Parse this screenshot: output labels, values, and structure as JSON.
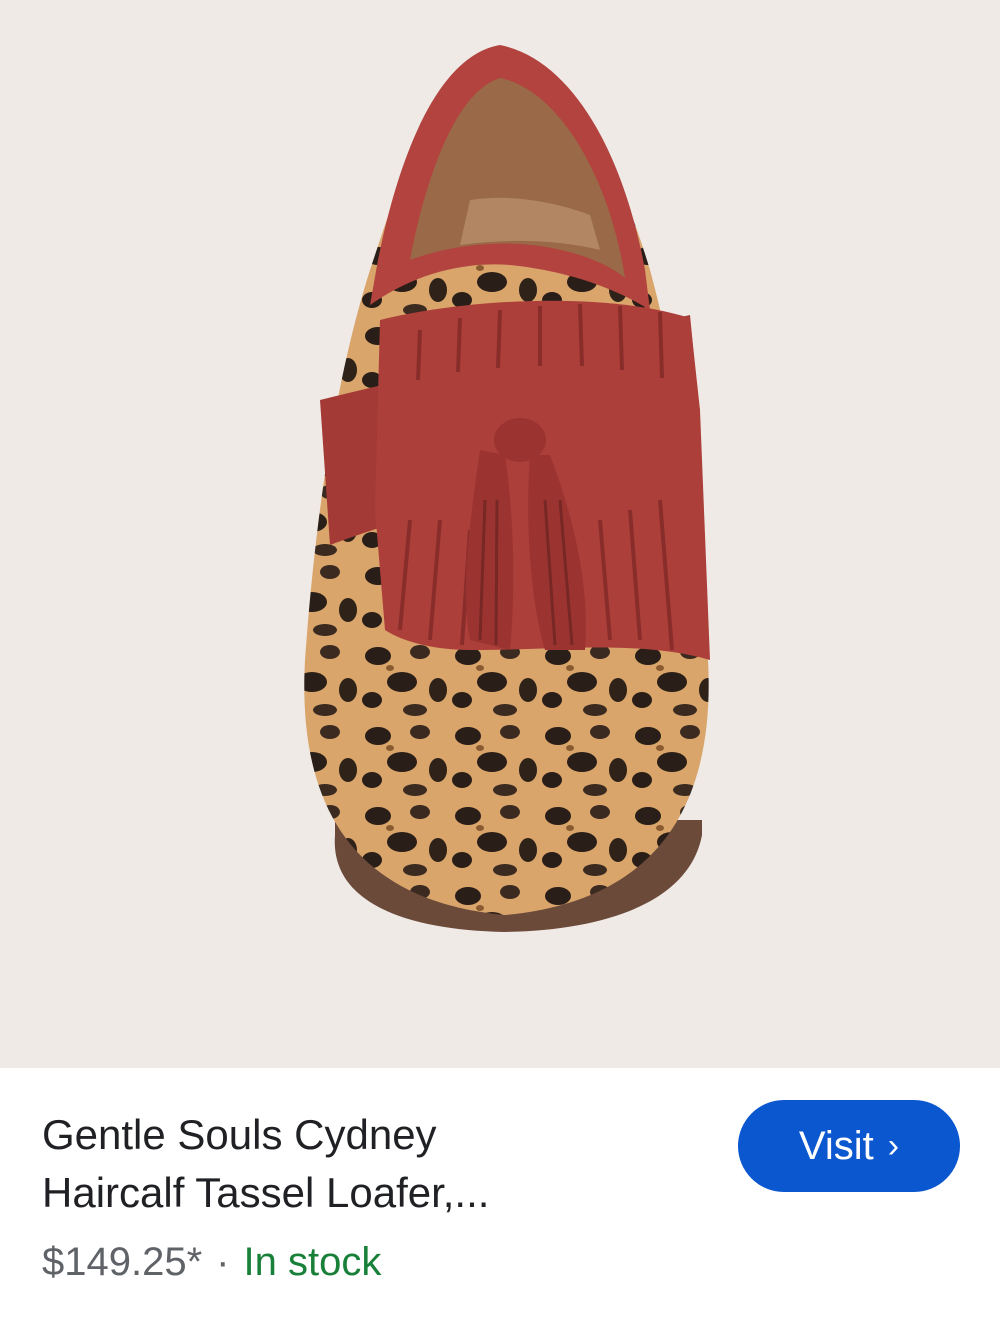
{
  "product": {
    "title_line1": "Gentle Souls Cydney",
    "title_line2": "Haircalf Tassel Loafer,...",
    "price": "$149.25*",
    "separator": "·",
    "stock_status": "In stock",
    "image_alt": "Gentle Souls Cydney Haircalf Tassel Loafer"
  },
  "visit": {
    "label": "Visit",
    "chevron": "›"
  },
  "colors": {
    "image_background": "#efeae6",
    "visit_button": "#0b57d0",
    "stock_green": "#188038",
    "title_text": "#202124",
    "price_text": "#5f6368"
  },
  "icons": {
    "visit_chevron": "chevron-right-icon"
  }
}
